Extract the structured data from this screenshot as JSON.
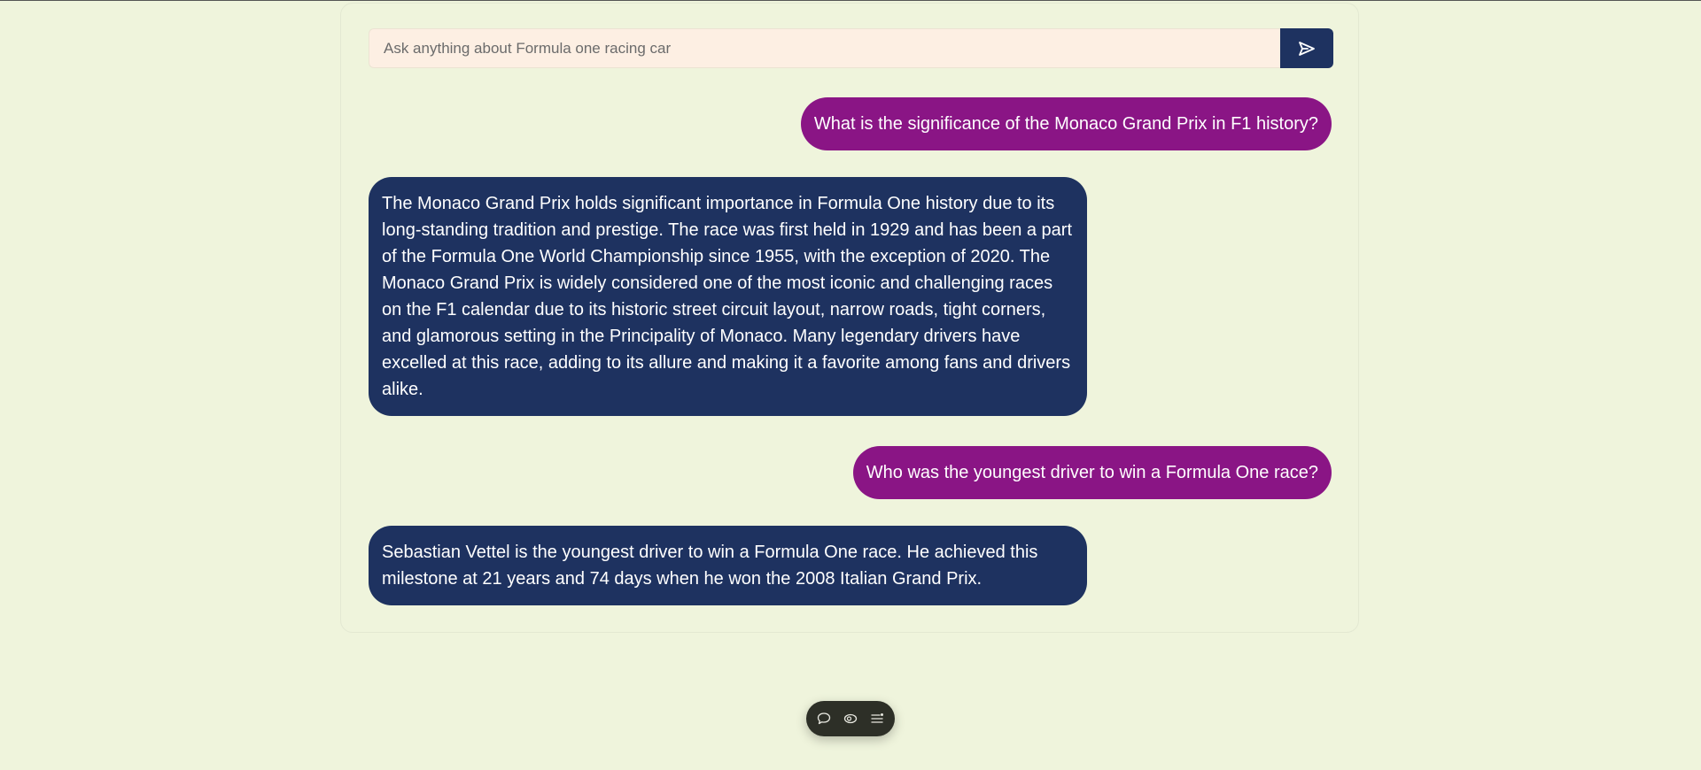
{
  "search": {
    "placeholder": "Ask anything about Formula one racing car",
    "value": ""
  },
  "send_button": {
    "icon": "send-icon"
  },
  "messages": [
    {
      "role": "user",
      "text": "What is the significance of the Monaco Grand Prix in F1 history?"
    },
    {
      "role": "assistant",
      "text": "The Monaco Grand Prix holds significant importance in Formula One history due to its long-standing tradition and prestige. The race was first held in 1929 and has been a part of the Formula One World Championship since 1955, with the exception of 2020. The Monaco Grand Prix is widely considered one of the most iconic and challenging races on the F1 calendar due to its historic street circuit layout, narrow roads, tight corners, and glamorous setting in the Principality of Monaco. Many legendary drivers have excelled at this race, adding to its allure and making it a favorite among fans and drivers alike."
    },
    {
      "role": "user",
      "text": "Who was the youngest driver to win a Formula One race?"
    },
    {
      "role": "assistant",
      "text": "Sebastian Vettel is the youngest driver to win a Formula One race. He achieved this milestone at 21 years and 74 days when he won the 2008 Italian Grand Prix."
    }
  ],
  "bottom_bar": {
    "icons": [
      "chat-bubble-icon",
      "toggle-icon",
      "list-settings-icon"
    ]
  },
  "colors": {
    "background": "#eff4dc",
    "user_bubble": "#8a1585",
    "assistant_bubble": "#1e3260",
    "input_background": "#fdefe3",
    "toolbar": "#2d2f27"
  }
}
